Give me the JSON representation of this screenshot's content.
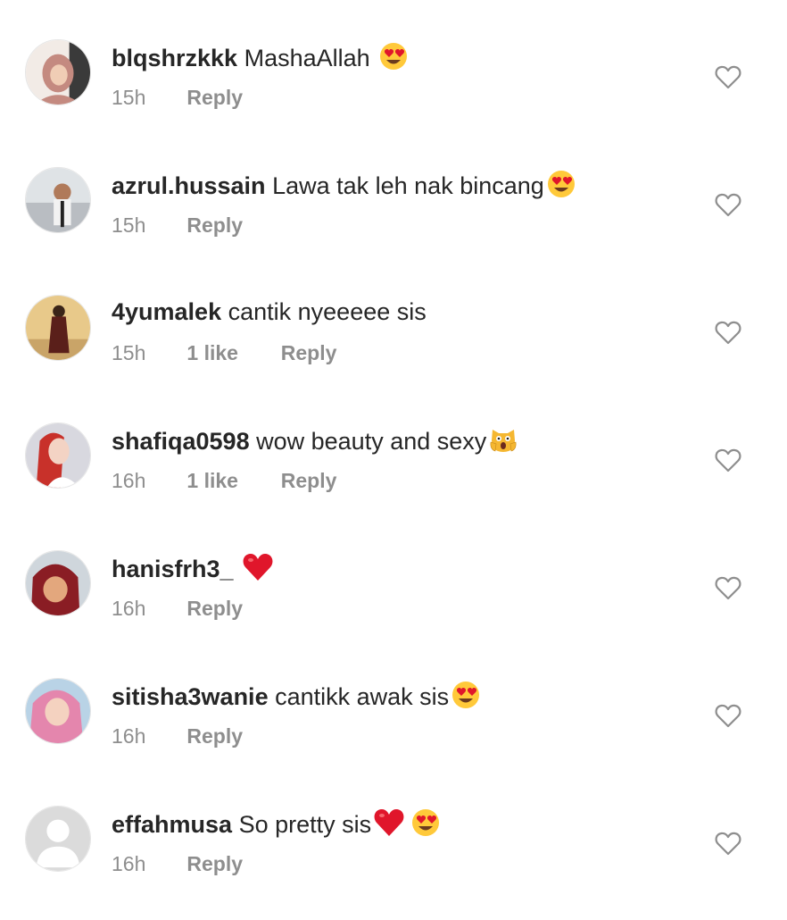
{
  "comments": [
    {
      "username": "blqshrzkkk",
      "text": "MashaAllah ",
      "emojis": [
        "heart-eyes"
      ],
      "time": "15h",
      "likes": "",
      "reply_label": "Reply",
      "avatar": "photo"
    },
    {
      "username": "azrul.hussain",
      "text": "Lawa tak leh nak bincang",
      "emojis": [
        "heart-eyes"
      ],
      "time": "15h",
      "likes": "",
      "reply_label": "Reply",
      "avatar": "photo"
    },
    {
      "username": "4yumalek",
      "text": "cantik nyeeeee sis",
      "emojis": [],
      "time": "15h",
      "likes": "1 like",
      "reply_label": "Reply",
      "avatar": "photo"
    },
    {
      "username": "shafiqa0598",
      "text": "wow beauty and sexy",
      "emojis": [
        "scream-cat"
      ],
      "time": "16h",
      "likes": "1 like",
      "reply_label": "Reply",
      "avatar": "photo"
    },
    {
      "username": "hanisfrh3_",
      "text": " ",
      "emojis": [
        "red-heart"
      ],
      "time": "16h",
      "likes": "",
      "reply_label": "Reply",
      "avatar": "photo"
    },
    {
      "username": "sitisha3wanie",
      "text": "cantikk awak sis",
      "emojis": [
        "heart-eyes"
      ],
      "time": "16h",
      "likes": "",
      "reply_label": "Reply",
      "avatar": "photo"
    },
    {
      "username": "effahmusa",
      "text": "So pretty sis",
      "emojis": [
        "red-heart",
        "heart-eyes"
      ],
      "time": "16h",
      "likes": "",
      "reply_label": "Reply",
      "avatar": "default"
    }
  ],
  "colors": {
    "text": "#262626",
    "muted": "#8e8e8e",
    "heart_outline": "#8e8e8e",
    "red_heart": "#e0162b",
    "emoji_face": "#ffc93a"
  },
  "icons": {
    "like_button": "heart-outline-icon",
    "default_avatar": "person-silhouette-icon"
  }
}
